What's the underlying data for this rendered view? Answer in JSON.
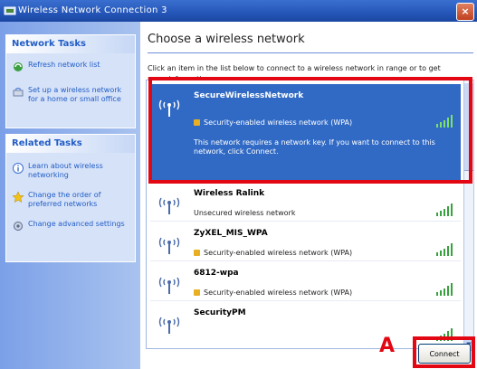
{
  "window": {
    "title": "Wireless Network Connection 3",
    "close_glyph": "×"
  },
  "sidebar": {
    "network_tasks": {
      "header": "Network Tasks",
      "items": [
        {
          "label": "Refresh network list",
          "icon": "refresh-icon"
        },
        {
          "label": "Set up a wireless network for a home or small office",
          "icon": "setup-network-icon"
        }
      ]
    },
    "related_tasks": {
      "header": "Related Tasks",
      "items": [
        {
          "label": "Learn about wireless networking",
          "icon": "info-icon"
        },
        {
          "label": "Change the order of preferred networks",
          "icon": "star-icon"
        },
        {
          "label": "Change advanced settings",
          "icon": "settings-icon"
        }
      ]
    }
  },
  "main": {
    "heading": "Choose a wireless network",
    "instructions": "Click an item in the list below to connect to a wireless network in range or to get more information.",
    "networks": [
      {
        "name": "SecureWirelessNetwork",
        "security": "Security-enabled wireless network (WPA)",
        "description": "This network requires a network key. If you want to connect to this network, click Connect.",
        "selected": true,
        "signal_bars": 5
      },
      {
        "name": "Wireless Ralink",
        "security": "Unsecured wireless network",
        "selected": false,
        "signal_bars": 5
      },
      {
        "name": "ZyXEL_MIS_WPA",
        "security": "Security-enabled wireless network (WPA)",
        "selected": false,
        "signal_bars": 5
      },
      {
        "name": "6812-wpa",
        "security": "Security-enabled wireless network (WPA)",
        "selected": false,
        "signal_bars": 5
      },
      {
        "name": "SecurityPM",
        "security": "",
        "selected": false,
        "signal_bars": 5
      }
    ],
    "connect_button": "Connect"
  },
  "annotation": {
    "label": "A",
    "color": "#e30613"
  },
  "colors": {
    "selection": "#316ac5",
    "title_bar": "#2456b8",
    "task_link": "#215dc6"
  }
}
